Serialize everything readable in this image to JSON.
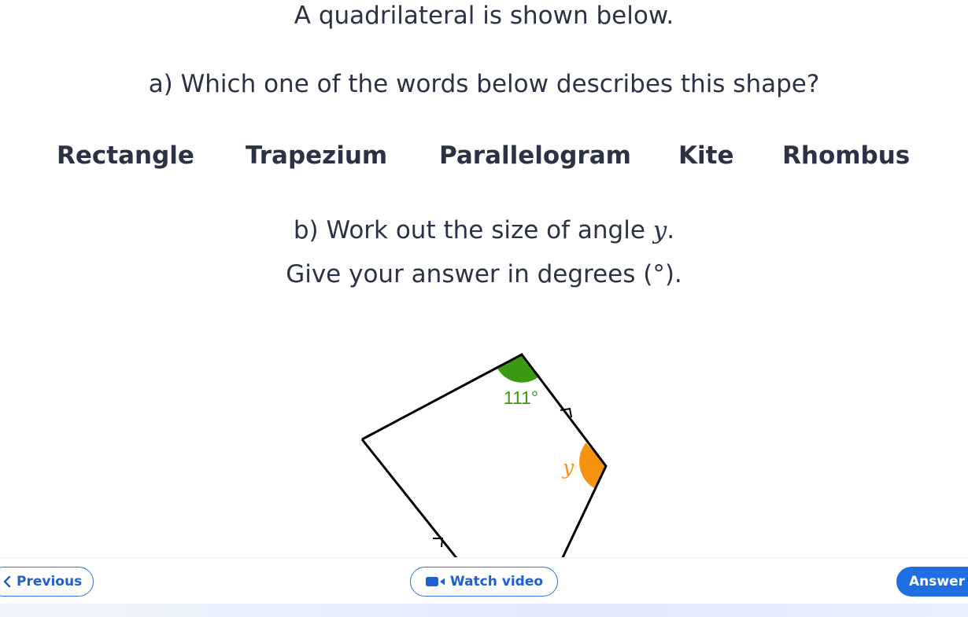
{
  "question": {
    "intro": "A quadrilateral is shown below.",
    "part_a": "a) Which one of the words below describes this shape?",
    "options": [
      "Rectangle",
      "Trapezium",
      "Parallelogram",
      "Kite",
      "Rhombus"
    ],
    "part_b_prefix": "b) Work out the size of angle ",
    "part_b_var": "y",
    "part_b_suffix": ".",
    "part_b_line2": "Give your answer in degrees (°)."
  },
  "diagram": {
    "known_angle_label": "111°",
    "unknown_angle_label": "y",
    "known_angle_color": "#3a9a12",
    "unknown_angle_color": "#f5920f"
  },
  "footer": {
    "previous_label": "Previous",
    "video_label": "Watch video",
    "answer_label": "Answer"
  },
  "colors": {
    "accent": "#1f6fe0",
    "text": "#2b3245"
  }
}
